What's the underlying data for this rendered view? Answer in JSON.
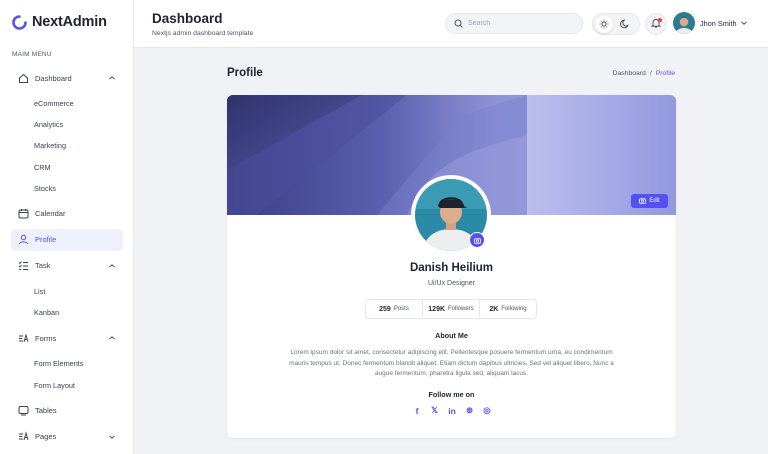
{
  "app": {
    "name": "NextAdmin"
  },
  "sidebar": {
    "menu_title": "MAIM MENU",
    "items": [
      {
        "label": "Dashboard",
        "icon": "home-icon",
        "expanded": true,
        "children": [
          "eCommerce",
          "Analytics",
          "Marketing",
          "CRM",
          "Stocks"
        ]
      },
      {
        "label": "Calendar",
        "icon": "calendar-icon"
      },
      {
        "label": "Profile",
        "icon": "user-icon",
        "active": true
      },
      {
        "label": "Task",
        "icon": "task-list-icon",
        "expanded": true,
        "children": [
          "List",
          "Kanban"
        ]
      },
      {
        "label": "Forms",
        "icon": "forms-icon",
        "expanded": true,
        "children": [
          "Form Elements",
          "Form Layout"
        ]
      },
      {
        "label": "Tables",
        "icon": "table-icon"
      },
      {
        "label": "Pages",
        "icon": "pages-icon",
        "expanded": false
      }
    ]
  },
  "header": {
    "title": "Dashboard",
    "subtitle": "Nextjs admin dashboard template",
    "search_placeholder": "Search",
    "user_name": "Jhon Smith"
  },
  "page": {
    "title": "Profile",
    "breadcrumb": {
      "parent": "Dashboard",
      "separator": "/",
      "current": "Profile"
    }
  },
  "profile": {
    "edit_label": "Edit",
    "name": "Danish Heilium",
    "role": "Ui/Ux Designer",
    "stats": [
      {
        "value": "259",
        "label": "Posts"
      },
      {
        "value": "129K",
        "label": "Followers"
      },
      {
        "value": "2K",
        "label": "Following"
      }
    ],
    "about_heading": "About Me",
    "about_text": "Lorem ipsum dolor sit amet, consectetur adipiscing elit. Pellentesque posuere fermentum urna, eu condimentum mauris tempus ut. Donec fermentum blandit aliquet. Etiam dictum dapibus ultricies. Sed vel aliquet libero. Nunc a augue fermentum, pharetra ligula sed, aliquam lacus.",
    "follow_heading": "Follow me on",
    "socials": [
      {
        "name": "facebook-icon",
        "glyph": "f"
      },
      {
        "name": "x-twitter-icon",
        "glyph": "𝕏"
      },
      {
        "name": "linkedin-icon",
        "glyph": "in"
      },
      {
        "name": "dribbble-icon",
        "glyph": "⊛"
      },
      {
        "name": "github-icon",
        "glyph": "◎"
      }
    ]
  },
  "colors": {
    "accent": "#5750f1",
    "text": "#1c2434",
    "muted": "#4b5563",
    "bg": "#f1f2f5"
  }
}
